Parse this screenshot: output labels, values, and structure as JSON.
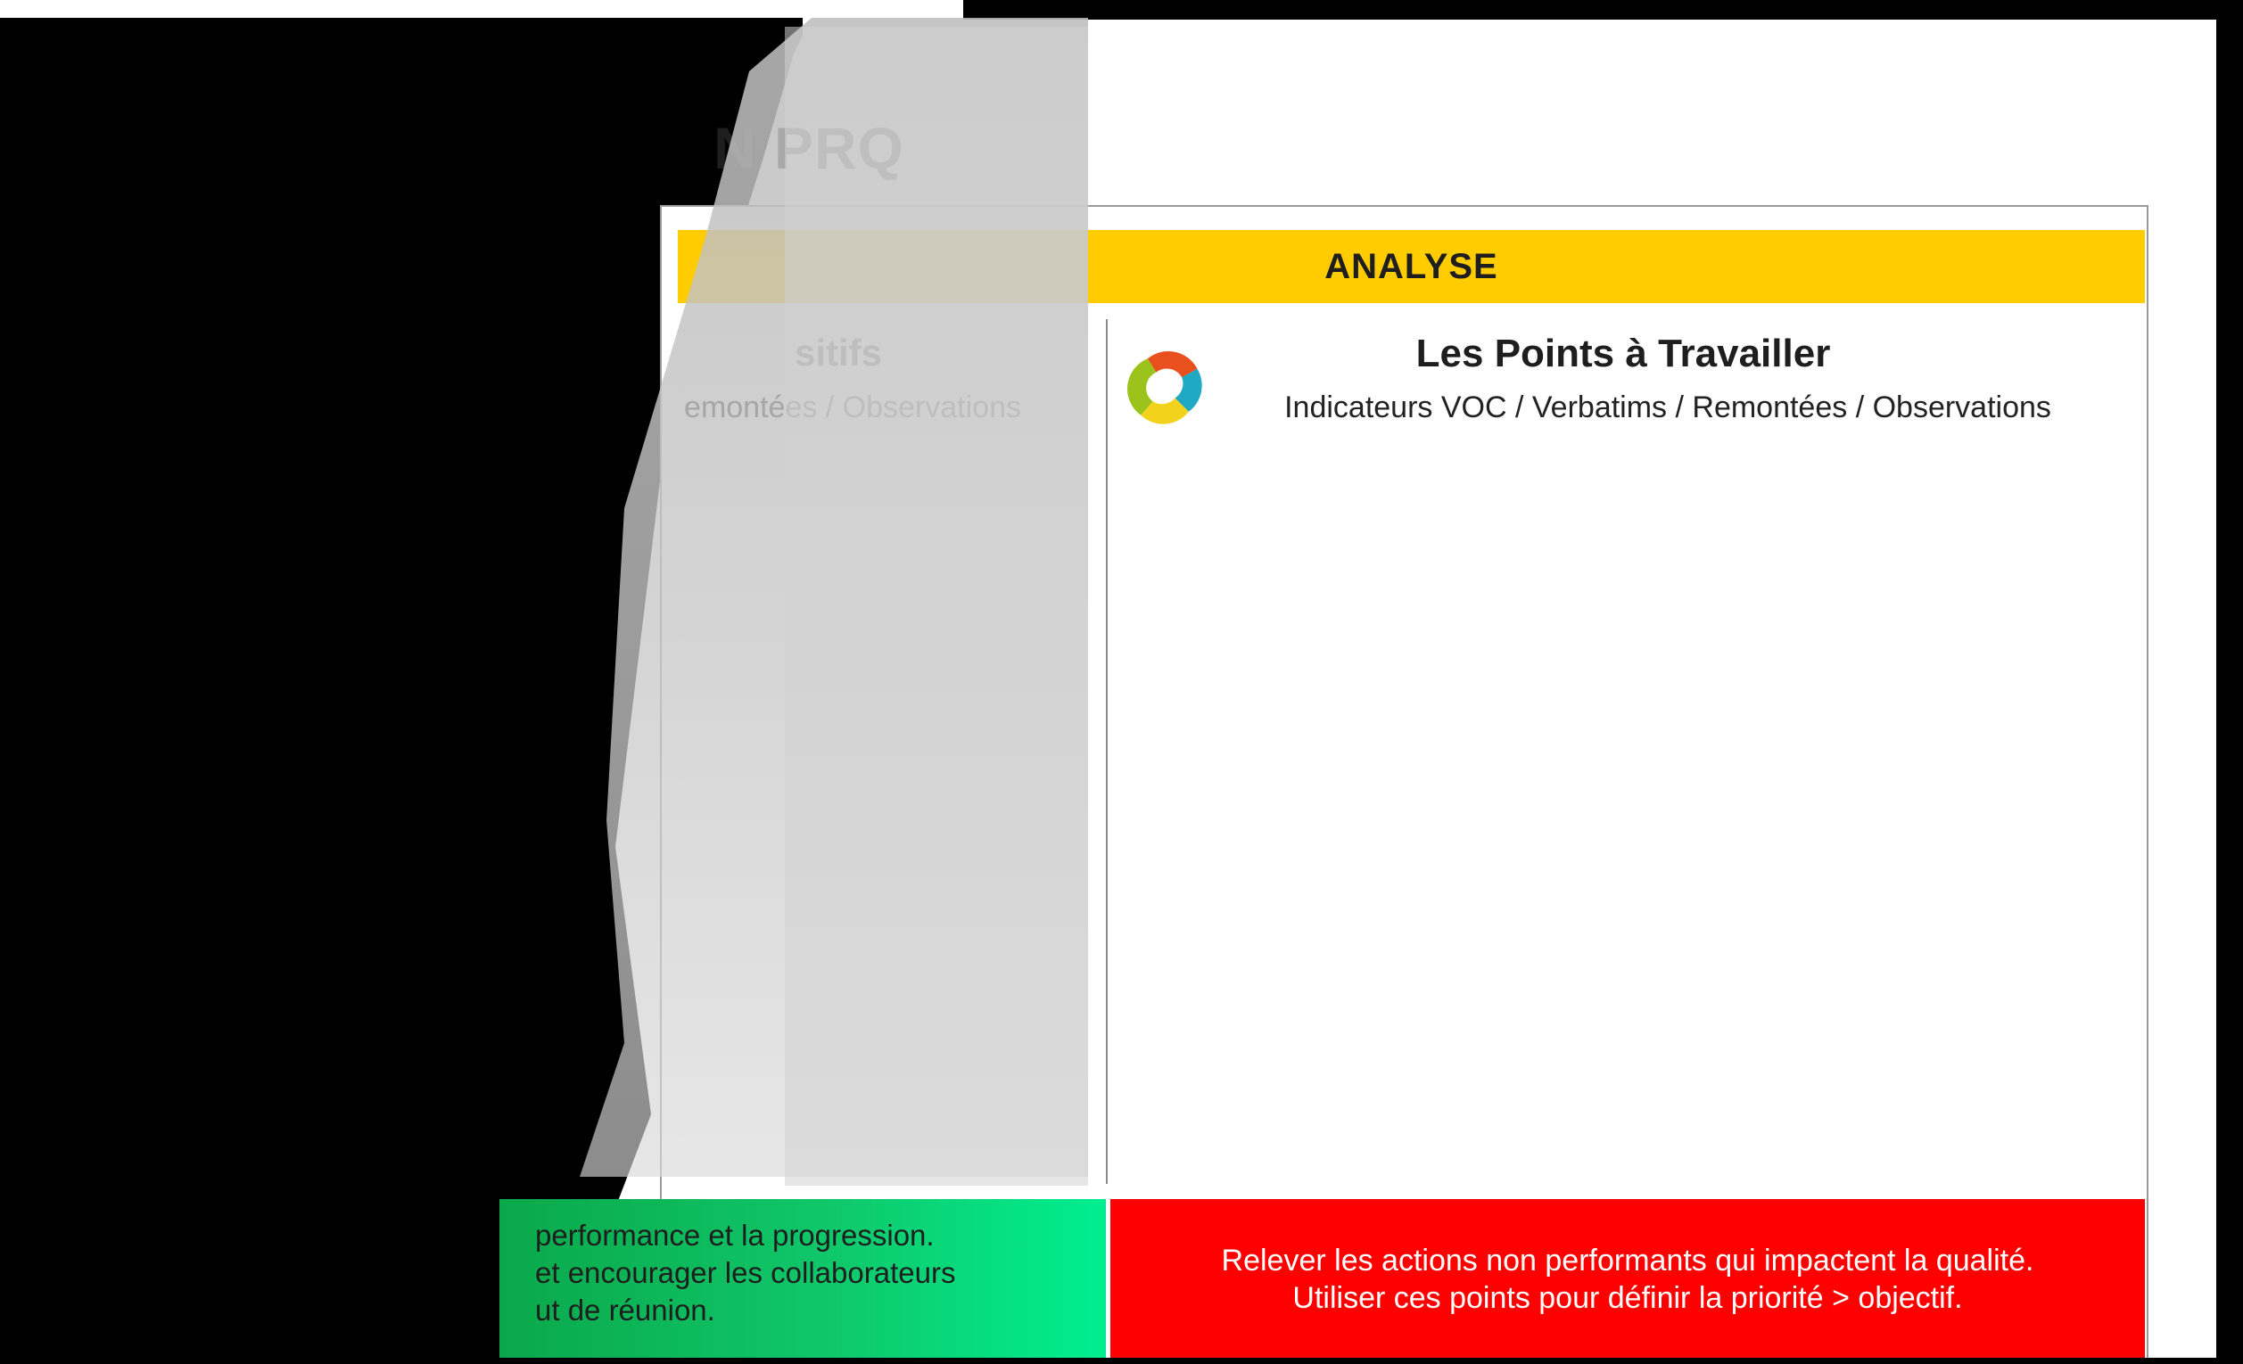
{
  "page": {
    "title": "N PRQ",
    "section_header": "ANALYSE"
  },
  "left_column": {
    "title": "sitifs",
    "subtitle": "emontées / Observations",
    "footer_lines": [
      "performance et la progression.",
      "et encourager les collaborateurs",
      "ut de réunion."
    ]
  },
  "right_column": {
    "title": "Les Points à Travailler",
    "subtitle": "Indicateurs VOC / Verbatims / Remontées / Observations",
    "footer_lines": [
      "Relever les actions non performants qui impactent la qualité.",
      "Utiliser ces points pour définir la priorité > objectif."
    ],
    "icon": "cycle-icon"
  },
  "colors": {
    "analyse_bar": "#ffcc00",
    "green_footer": "#0fc86a",
    "red_footer": "#ff0000"
  }
}
